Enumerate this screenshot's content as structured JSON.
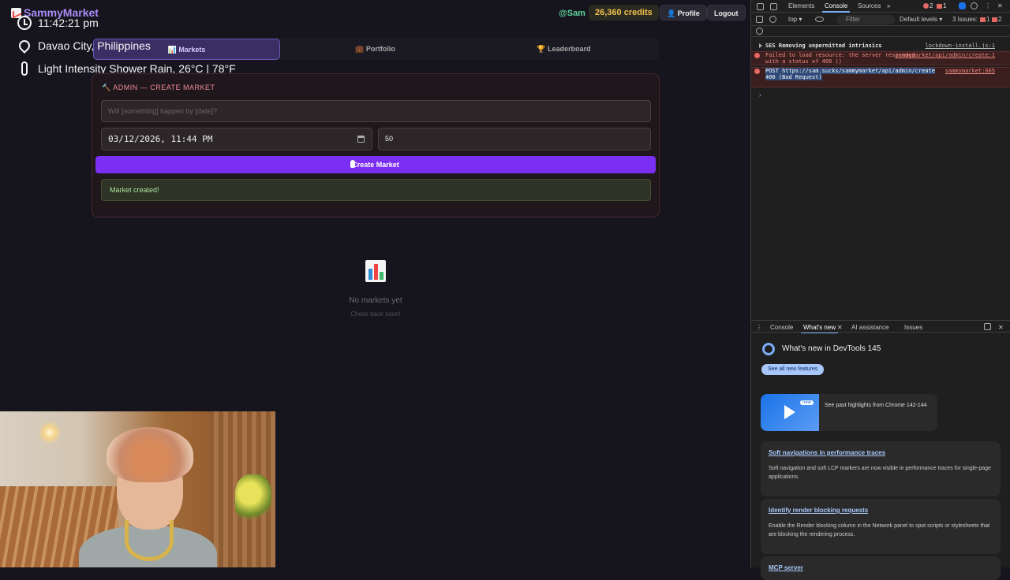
{
  "app": {
    "brand": "SammyMarket",
    "user_handle": "@Sam",
    "credits": "26,360 credits",
    "profile_label": "👤 Profile",
    "logout_label": "Logout"
  },
  "overlay": {
    "time": "11:42:21 pm",
    "location": "Davao City, Philippines",
    "weather": "Light Intensity Shower Rain, 26°C | 78°F"
  },
  "tabs": [
    {
      "label": "📊 Markets",
      "active": true
    },
    {
      "label": "💼 Portfolio",
      "active": false
    },
    {
      "label": "🏆 Leaderboard",
      "active": false
    }
  ],
  "admin": {
    "title": "🔨 ADMIN — CREATE MARKET",
    "question_placeholder": "Will [something] happen by [date]?",
    "date_value": "03/12/2026, 11:44 PM",
    "amount_value": "50",
    "create_label": "Create Market",
    "success_message": "Market created!"
  },
  "empty": {
    "title": "No markets yet",
    "subtitle": "Check back soon!"
  },
  "devtools": {
    "tabs": [
      "Elements",
      "Console",
      "Sources"
    ],
    "more": "»",
    "errors_count": "2",
    "warnings_count": "1",
    "context": "top ▾",
    "filter_placeholder": "Filter",
    "levels": "Default levels ▾",
    "issues": "3 Issues:",
    "issues_err": "1",
    "issues_warn": "2",
    "logs": [
      {
        "text": "SES Removing unpermitted intrinsics",
        "source": "lockdown-install.js:1",
        "level": "info"
      },
      {
        "text": "Failed to load resource: the server responded with a status of 400 ()",
        "source": "sammymarket/api/admin/create:1",
        "level": "error"
      },
      {
        "text": "POST https://sam.sucks/sammymarket/api/admin/create 400 (Bad Request)",
        "source": "sammymarket:665",
        "level": "error"
      }
    ],
    "drawer_tabs": [
      "Console",
      "What's new",
      "AI assistance",
      "Issues"
    ],
    "whats_new_title": "What's new in DevTools 145",
    "see_all": "See all new features",
    "video_badge": "new",
    "video_text": "See past highlights from Chrome 142-144",
    "features": [
      {
        "title": "Soft navigations in performance traces",
        "desc": "Soft navigation and soft LCP markers are now visible in performance traces for single-page applications."
      },
      {
        "title": "Identify render blocking requests",
        "desc": "Enable the Render blocking column in the Network panel to spot scripts or stylesheets that are blocking the rendering process."
      },
      {
        "title": "MCP server",
        "desc": ""
      }
    ]
  }
}
